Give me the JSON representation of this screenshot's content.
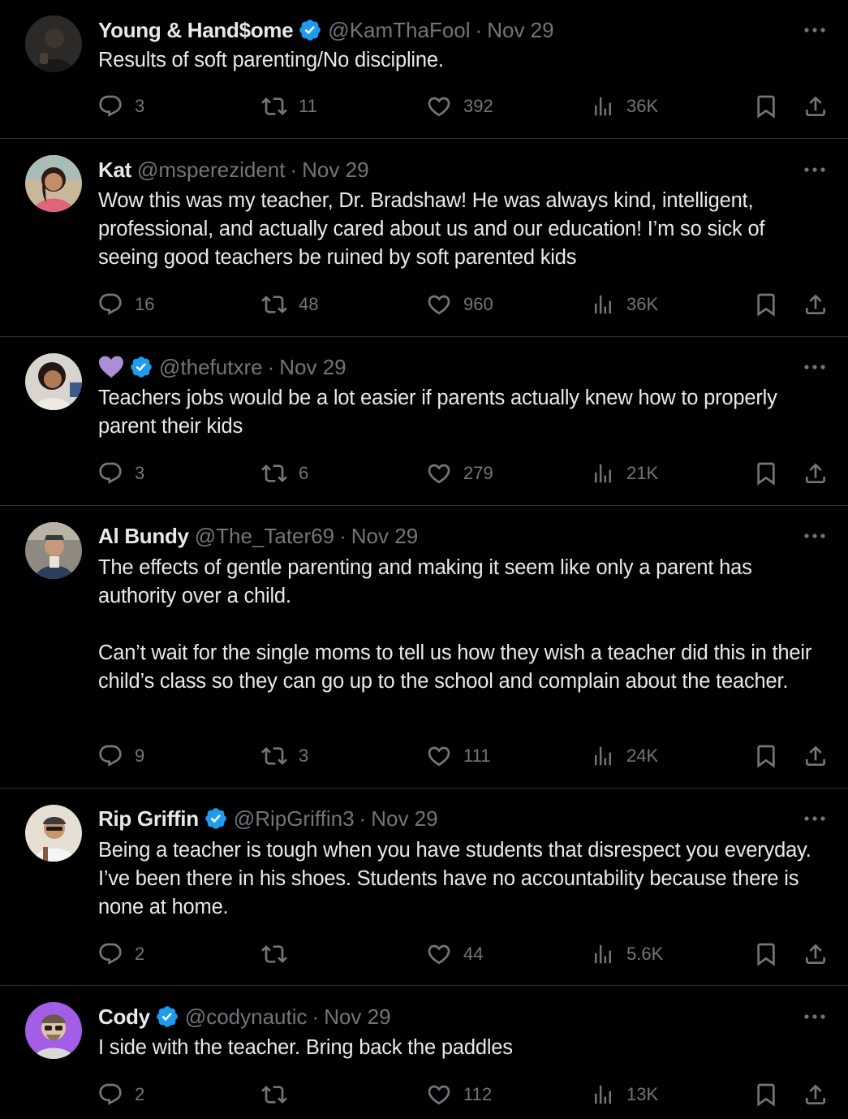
{
  "tweets": [
    {
      "name": "Young & Hand$ome",
      "verified": true,
      "handle": "@KamThaFool",
      "date": "Nov 29",
      "text": [
        "Results of soft parenting/No discipline."
      ],
      "replies": "3",
      "reposts": "11",
      "likes": "392",
      "views": "36K"
    },
    {
      "name": "Kat",
      "verified": false,
      "handle": "@msperezident",
      "date": "Nov 29",
      "text": [
        "Wow this was my teacher, Dr. Bradshaw! He was always kind, intelligent, professional, and actually cared about us and our education! I’m so sick of seeing good teachers be ruined by soft parented kids"
      ],
      "replies": "16",
      "reposts": "48",
      "likes": "960",
      "views": "36K"
    },
    {
      "name": "",
      "name_emoji": "purple-heart",
      "verified": true,
      "handle": "@thefutxre",
      "date": "Nov 29",
      "text": [
        "Teachers jobs would be a lot easier if parents actually knew how to properly parent their kids"
      ],
      "replies": "3",
      "reposts": "6",
      "likes": "279",
      "views": "21K"
    },
    {
      "name": "Al Bundy",
      "verified": false,
      "handle": "@The_Tater69",
      "date": "Nov 29",
      "text": [
        "The effects of gentle parenting and making it seem like only a parent has authority over a child.",
        "Can’t wait for the single moms to tell us how they wish a teacher did this in their child’s class so they can go up to the school and complain about the teacher."
      ],
      "replies": "9",
      "reposts": "3",
      "likes": "111",
      "views": "24K"
    },
    {
      "name": "Rip Griffin",
      "verified": true,
      "handle": "@RipGriffin3",
      "date": "Nov 29",
      "text": [
        "Being a teacher is tough when you have students that disrespect you everyday. I’ve been there in his shoes. Students have no accountability because there is none at home."
      ],
      "replies": "2",
      "reposts": "",
      "likes": "44",
      "views": "5.6K"
    },
    {
      "name": "Cody",
      "verified": true,
      "handle": "@codynautic",
      "date": "Nov 29",
      "text": [
        "I side with the teacher. Bring back the paddles"
      ],
      "replies": "2",
      "reposts": "",
      "likes": "112",
      "views": "13K"
    }
  ],
  "separator": "·",
  "icons": {
    "reply": "reply-icon",
    "repost": "repost-icon",
    "like": "like-icon",
    "views": "views-icon",
    "bookmark": "bookmark-icon",
    "share": "share-icon",
    "more": "more-icon",
    "verified": "verified-badge-icon"
  },
  "colors": {
    "background": "#000000",
    "text": "#e7e9ea",
    "muted": "#71767b",
    "divider": "#2f3336",
    "verified": "#1d9bf0",
    "heart_emoji": "#aa8ed6"
  }
}
